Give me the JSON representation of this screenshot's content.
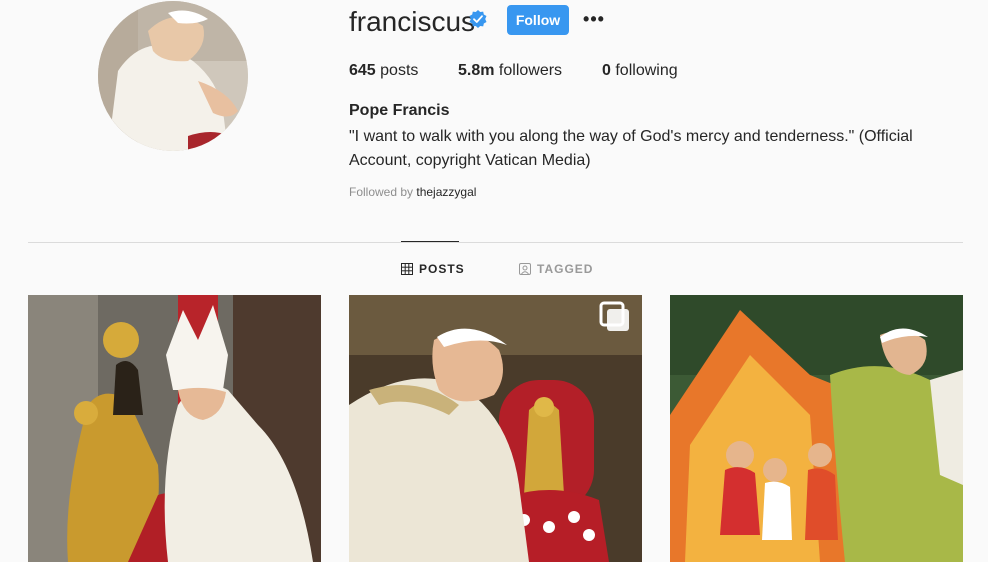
{
  "profile": {
    "username": "franciscus",
    "follow_label": "Follow",
    "more_label": "•••",
    "stats": {
      "posts_count": "645",
      "posts_label": "posts",
      "followers_count": "5.8m",
      "followers_label": "followers",
      "following_count": "0",
      "following_label": "following"
    },
    "full_name": "Pope Francis",
    "bio": "\"I want to walk with you along the way of God's mercy and tenderness.\" (Official Account, copyright Vatican Media)",
    "followed_by_prefix": "Followed by",
    "followed_by_user": "thejazzygal"
  },
  "tabs": [
    {
      "label": "POSTS",
      "active": true
    },
    {
      "label": "TAGGED",
      "active": false
    }
  ],
  "colors": {
    "accent": "#3897f0",
    "background": "#fafafa",
    "text": "#262626",
    "muted": "#8e8e8e"
  },
  "icons": {
    "verified": "verified-badge-icon",
    "more": "more-options-icon",
    "posts_tab": "grid-icon",
    "tagged_tab": "tagged-person-icon",
    "carousel": "carousel-multiple-icon"
  }
}
